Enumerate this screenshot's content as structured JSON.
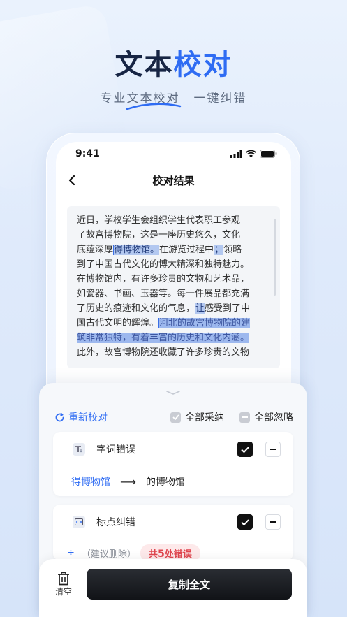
{
  "hero": {
    "title_part1": "文本",
    "title_part2": "校对",
    "subtitle_left": "专业文本校对",
    "subtitle_right": "一键纠错"
  },
  "status_bar": {
    "time": "9:41"
  },
  "nav": {
    "title": "校对结果"
  },
  "document": {
    "l1": "近日，学校学生会组织学生代表职工参观",
    "l2": "了故宫博物院，这是一座历史悠久，文化",
    "l3a": "底蕴深厚",
    "l3b": "得博物馆。",
    "l3c": "在游览过程中",
    "l3d": "；",
    "l3e": "领略",
    "l4": "到了中国古代文化的博大精深和独特魅力。",
    "l5": "在博物馆内，有许多珍贵的文物和艺术品，",
    "l6": "如瓷器、书画、玉器等。每一件展品都充满",
    "l7a": "了历史的痕迹和文化的气息，",
    "l7b": "让",
    "l7c": "感受到了中",
    "l8a": "国古代文明的辉煌。",
    "l8b": "河北的故宫博物院的建",
    "l9": "筑非常独特，有着丰富的历史和文化内涵。",
    "l10": "此外，故宫博物院还收藏了许多珍贵的文物"
  },
  "panel": {
    "recheck_label": "重新校对",
    "accept_all_label": "全部采纳",
    "ignore_all_label": "全部忽略",
    "cards": [
      {
        "title": "字词错误",
        "wrong": "得博物馆",
        "arrow": "⟶",
        "correct": "的博物馆"
      },
      {
        "title": "标点纠错"
      }
    ],
    "hint_symbol": "÷",
    "hint_text": "（建议删除）",
    "error_badge_prefix": "共",
    "error_badge_count": "5",
    "error_badge_suffix": "处错误"
  },
  "bottom": {
    "clear_label": "清空",
    "copy_label": "复制全文"
  },
  "colors": {
    "accent": "#2f6cf3",
    "dark": "#172544",
    "error": "#e0464f"
  }
}
